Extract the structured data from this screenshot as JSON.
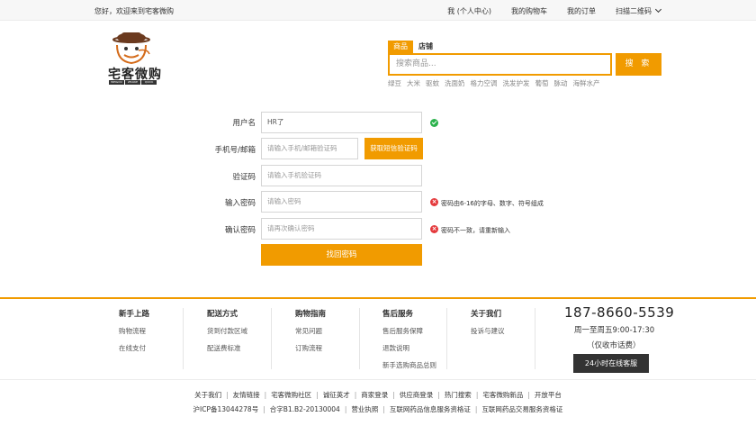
{
  "topbar": {
    "welcome": "您好，欢迎来到宅客微购",
    "links": [
      "我 (个人中心)",
      "我的购物车",
      "我的订单",
      "扫描二维码"
    ]
  },
  "logo": {
    "text": "宅客微购",
    "sub": [
      "WEIGOU",
      "ZHAIKE",
      "QUICK SHOPPING"
    ]
  },
  "search": {
    "tabs": [
      "商品",
      "店铺"
    ],
    "placeholder": "搜索商品...",
    "button": "搜 索",
    "hot": [
      "绿豆",
      "大米",
      "驱蚊",
      "洗面奶",
      "格力空调",
      "洗发护发",
      "葡萄",
      "脉动",
      "海鲜水产"
    ]
  },
  "form": {
    "username_label": "用户名",
    "username_value": "HR了",
    "phone_label": "手机号/邮箱",
    "phone_placeholder": "请输入手机/邮箱验证码",
    "sms_button": "获取短信验证码",
    "code_label": "验证码",
    "code_placeholder": "请输入手机验证码",
    "pwd_label": "输入密码",
    "pwd_placeholder": "请输入密码",
    "pwd_error": "密码由6-16的字母、数字、符号组成",
    "confirm_label": "确认密码",
    "confirm_placeholder": "请再次确认密码",
    "confirm_error": "密码不一致，请重新输入",
    "submit": "找回密码"
  },
  "footer": {
    "columns": [
      {
        "title": "新手上路",
        "items": [
          "购物流程",
          "在线支付"
        ]
      },
      {
        "title": "配送方式",
        "items": [
          "货到付款区域",
          "配送费标准"
        ]
      },
      {
        "title": "购物指南",
        "items": [
          "常见问题",
          "订购流程"
        ]
      },
      {
        "title": "售后服务",
        "items": [
          "售后服务保障",
          "退款说明",
          "新手选购商品总则"
        ]
      },
      {
        "title": "关于我们",
        "items": [
          "投诉与建议"
        ]
      }
    ],
    "phone": "187-8660-5539",
    "hours": "周一至周五9:00-17:30",
    "hours_note": "（仅收市话费）",
    "service_button": "24小时在线客服",
    "links": [
      "关于我们",
      "友情链接",
      "宅客微购社区",
      "诚征英才",
      "商家登录",
      "供应商登录",
      "热门搜索",
      "宅客微购新品",
      "开放平台"
    ],
    "links2": [
      "沪ICP备13044278号",
      "合字B1.B2-20130004",
      "营业执照",
      "互联网药品信息服务资格证",
      "互联网药品交易服务资格证"
    ]
  }
}
